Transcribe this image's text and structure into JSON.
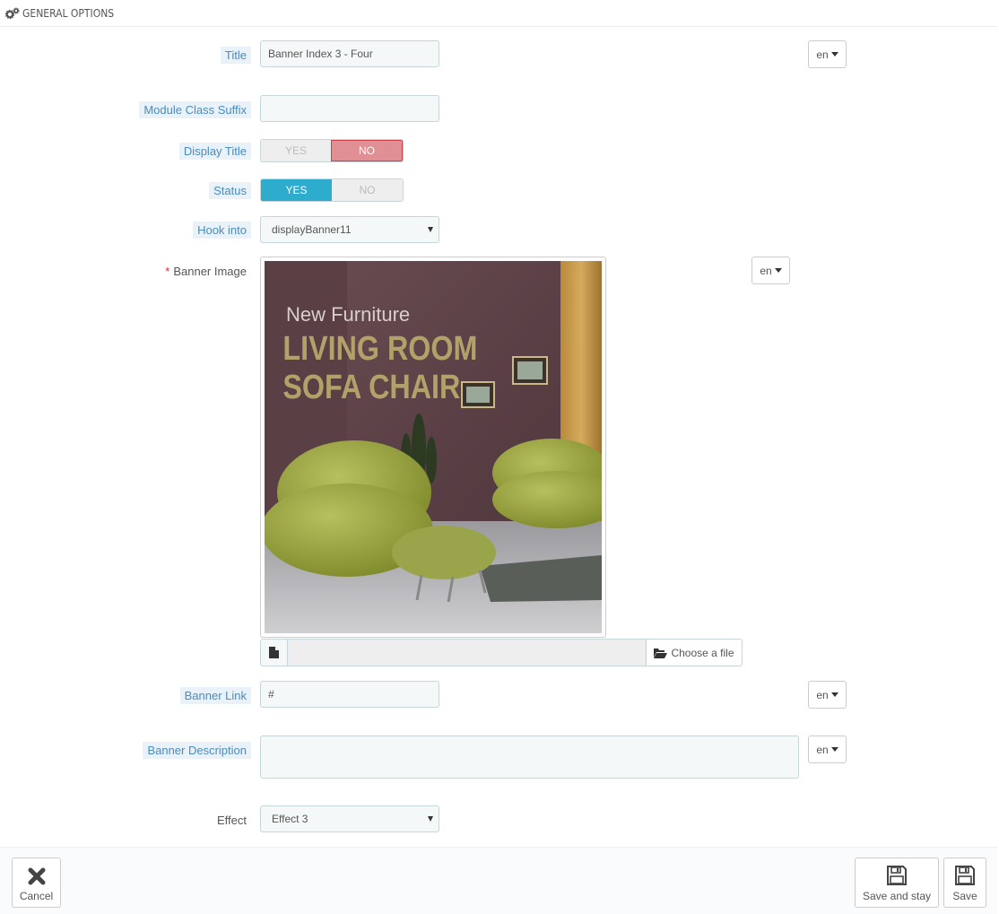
{
  "heading": {
    "title": "GENERAL OPTIONS",
    "icon": "cogs-icon"
  },
  "fields": {
    "title": {
      "label": "Title",
      "value": "Banner Index 3 - Four",
      "lang": "en"
    },
    "module_class_suffix": {
      "label": "Module Class Suffix",
      "value": ""
    },
    "display_title": {
      "label": "Display Title",
      "yes": "YES",
      "no": "NO",
      "selected": "NO"
    },
    "status": {
      "label": "Status",
      "yes": "YES",
      "no": "NO",
      "selected": "YES"
    },
    "hook_into": {
      "label": "Hook into",
      "value": "displayBanner11"
    },
    "banner_image": {
      "required_mark": "*",
      "label": "Banner Image",
      "lang": "en",
      "image_text": {
        "line1": "New Furniture",
        "line2": "LIVING ROOM",
        "line3": "SOFA CHAIR"
      },
      "choose_file": "Choose a file"
    },
    "banner_link": {
      "label": "Banner Link",
      "value": "#",
      "lang": "en"
    },
    "banner_description": {
      "label": "Banner Description",
      "value": "",
      "lang": "en"
    },
    "effect": {
      "label": "Effect",
      "value": "Effect 3"
    }
  },
  "footer": {
    "cancel": "Cancel",
    "save_and_stay": "Save and stay",
    "save": "Save"
  },
  "colors": {
    "label_hint_bg": "#e9f2f8",
    "label_hint_text": "#4b8bbe",
    "switch_yes_active": "#2eacce",
    "switch_no_active": "#e08f95",
    "required": "#e0242f"
  }
}
